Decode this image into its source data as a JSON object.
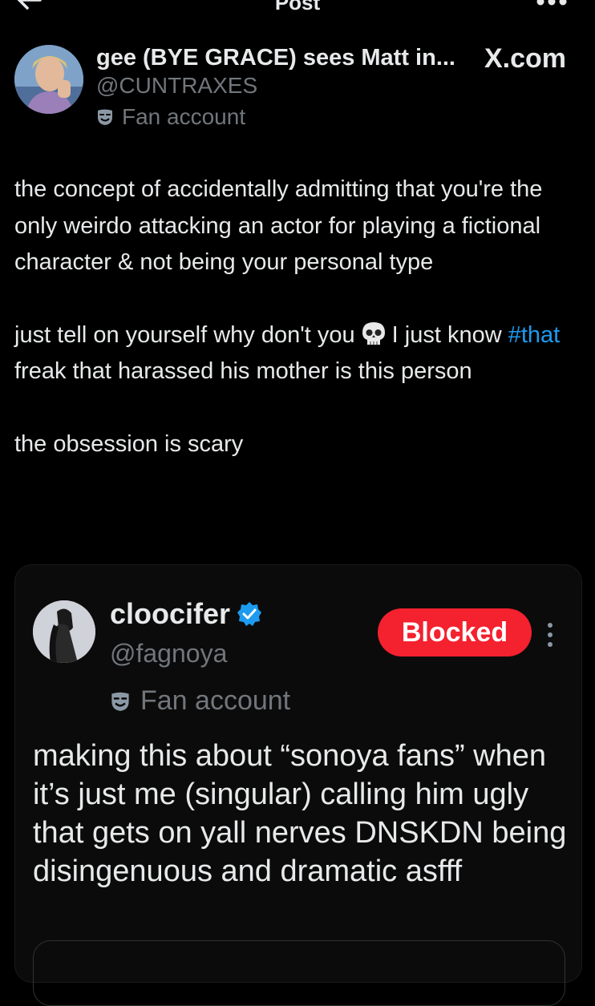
{
  "header": {
    "title": "Post"
  },
  "post": {
    "author_name": "gee (BYE GRACE) sees Matt in...",
    "author_handle": "@CUNTRAXES",
    "badge": "Fan account",
    "source": "X.com",
    "paragraph1": "the concept of accidentally admitting that you're the only weirdo attacking an actor for playing a fictional character & not being your personal type",
    "p2_before": "just tell on yourself why don't you",
    "p2_mid": "I just know",
    "hashtag": "#that",
    "p2_after": "freak that harassed his mother is this person",
    "paragraph3": "the obsession is scary"
  },
  "quote": {
    "name": "cloocifer",
    "handle": "@fagnoya",
    "badge": "Fan account",
    "blocked_label": "Blocked",
    "text": "making this about “sonoya fans” when it’s just me (singular) calling him ugly that gets on yall nerves DNSKDN being disingenuous and dramatic asfff"
  },
  "colors": {
    "background": "#000000",
    "link": "#1d9bf0",
    "blocked": "#f4212e",
    "verified": "#1d9bf0",
    "muted": "#71767b"
  },
  "icons": [
    "back-arrow-icon",
    "more-icon",
    "fan-mask-icon",
    "skull-icon",
    "verified-badge-icon",
    "more-vertical-icon"
  ]
}
